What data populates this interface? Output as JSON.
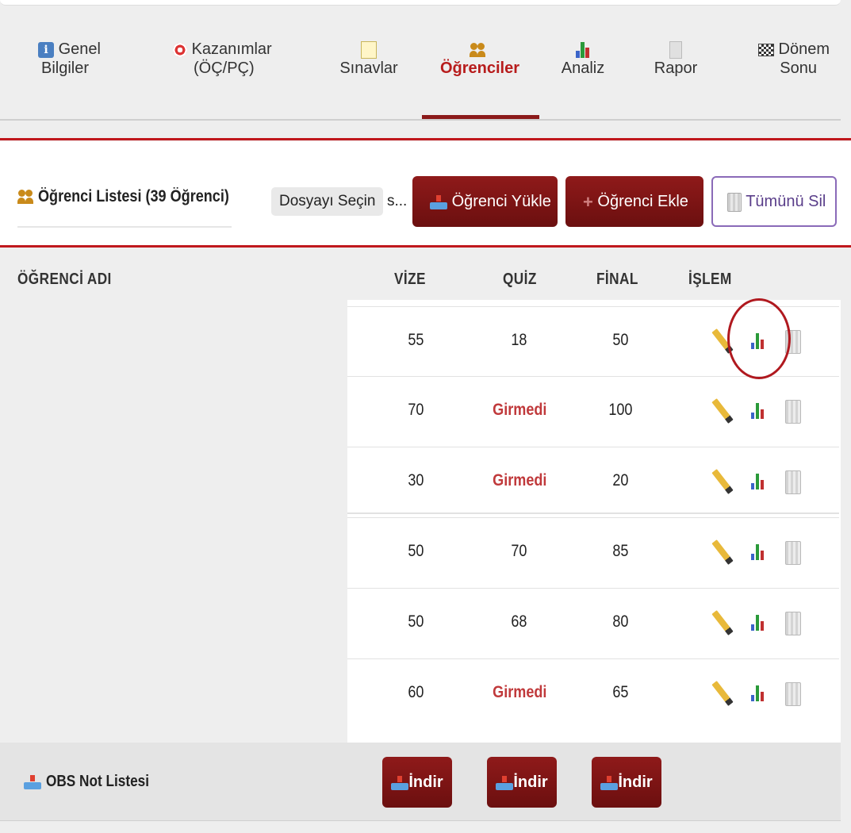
{
  "tabs": [
    {
      "line1": "Genel",
      "line2": "Bilgiler",
      "icon": "info-icon"
    },
    {
      "line1": "Kazanımlar",
      "line2": "(ÖÇ/PÇ)",
      "icon": "target-icon"
    },
    {
      "line1": "",
      "line2": "Sınavlar",
      "icon": "notepad-icon"
    },
    {
      "line1": "",
      "line2": "Öğrenciler",
      "icon": "people-icon",
      "active": true
    },
    {
      "line1": "",
      "line2": "Analiz",
      "icon": "bar-chart-icon"
    },
    {
      "line1": "",
      "line2": "Rapor",
      "icon": "document-icon"
    },
    {
      "line1": "Dönem",
      "line2": "Sonu",
      "icon": "checkered-flag-icon"
    }
  ],
  "list_header": {
    "title": "Öğrenci Listesi (39 Öğrenci)",
    "file_button": "Dosyayı Seçin",
    "file_name": "s...",
    "upload_button": "Öğrenci Yükle",
    "add_button": "Öğrenci Ekle",
    "delete_all_button": "Tümünü Sil"
  },
  "table": {
    "headers": {
      "name": "ÖĞRENCİ ADI",
      "vize": "VİZE",
      "quiz": "QUİZ",
      "final": "FİNAL",
      "islem": "İŞLEM"
    },
    "rows": [
      {
        "vize": "55",
        "quiz": "18",
        "final": "50",
        "quiz_absent": false
      },
      {
        "vize": "70",
        "quiz": "Girmedi",
        "final": "100",
        "quiz_absent": true
      },
      {
        "vize": "30",
        "quiz": "Girmedi",
        "final": "20",
        "quiz_absent": true
      },
      {
        "vize": "50",
        "quiz": "70",
        "final": "85",
        "quiz_absent": false
      },
      {
        "vize": "50",
        "quiz": "68",
        "final": "80",
        "quiz_absent": false
      },
      {
        "vize": "60",
        "quiz": "Girmedi",
        "final": "65",
        "quiz_absent": true
      }
    ]
  },
  "footer": {
    "label": "OBS Not Listesi",
    "download_label": "İndir"
  },
  "colors": {
    "accent": "#b71c1c",
    "button_dark_red": "#7a1212",
    "absent_text": "#c0393b",
    "outline_purple": "#8a6ab8"
  }
}
